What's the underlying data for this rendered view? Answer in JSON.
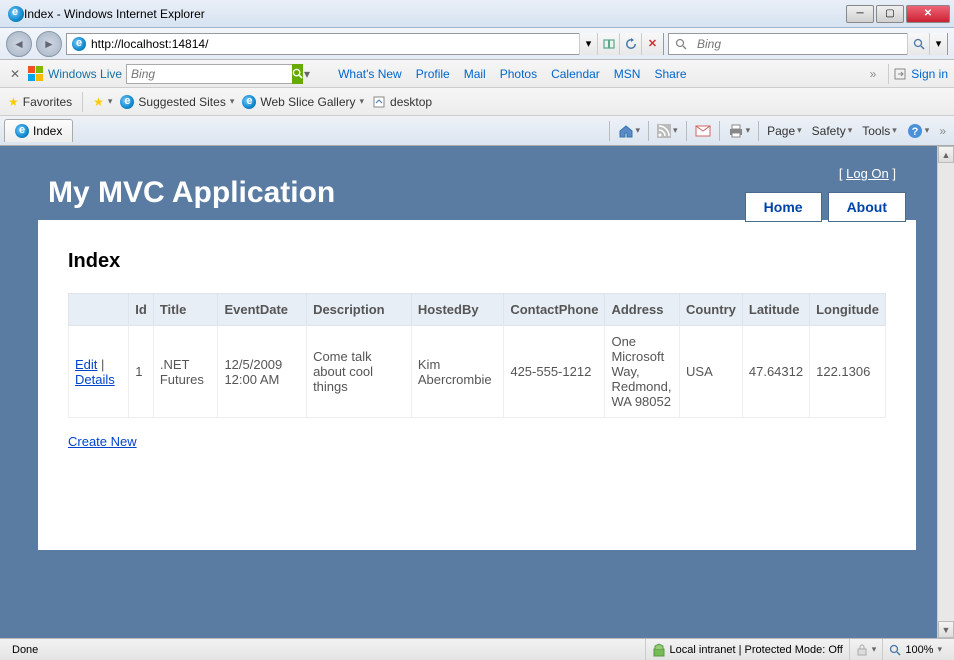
{
  "window": {
    "title": "Index - Windows Internet Explorer"
  },
  "address": {
    "url": "http://localhost:14814/"
  },
  "search": {
    "placeholder": "Bing"
  },
  "livebar": {
    "brand": "Windows Live",
    "search_placeholder": "Bing",
    "links": [
      "What's New",
      "Profile",
      "Mail",
      "Photos",
      "Calendar",
      "MSN",
      "Share"
    ],
    "signin": "Sign in"
  },
  "favbar": {
    "favorites": "Favorites",
    "suggested": "Suggested Sites",
    "webslice": "Web Slice Gallery",
    "desktop": "desktop"
  },
  "tab": {
    "label": "Index"
  },
  "cmd": {
    "page": "Page",
    "safety": "Safety",
    "tools": "Tools"
  },
  "app": {
    "logon_left": "[ ",
    "logon_link": "Log On",
    "logon_right": " ]",
    "title": "My MVC Application",
    "menu": {
      "home": "Home",
      "about": "About"
    }
  },
  "content": {
    "heading": "Index",
    "columns": [
      "",
      "Id",
      "Title",
      "EventDate",
      "Description",
      "HostedBy",
      "ContactPhone",
      "Address",
      "Country",
      "Latitude",
      "Longitude"
    ],
    "row": {
      "edit": "Edit",
      "sep": " | ",
      "details": "Details",
      "id": "1",
      "title": ".NET Futures",
      "eventdate": "12/5/2009 12:00 AM",
      "description": "Come talk about cool things",
      "hostedby": "Kim Abercrombie",
      "contactphone": "425-555-1212",
      "address": "One Microsoft Way, Redmond, WA 98052",
      "country": "USA",
      "latitude": "47.64312",
      "longitude": "122.1306"
    },
    "create": "Create New"
  },
  "status": {
    "done": "Done",
    "zone": "Local intranet | Protected Mode: Off",
    "zoom": "100%"
  }
}
